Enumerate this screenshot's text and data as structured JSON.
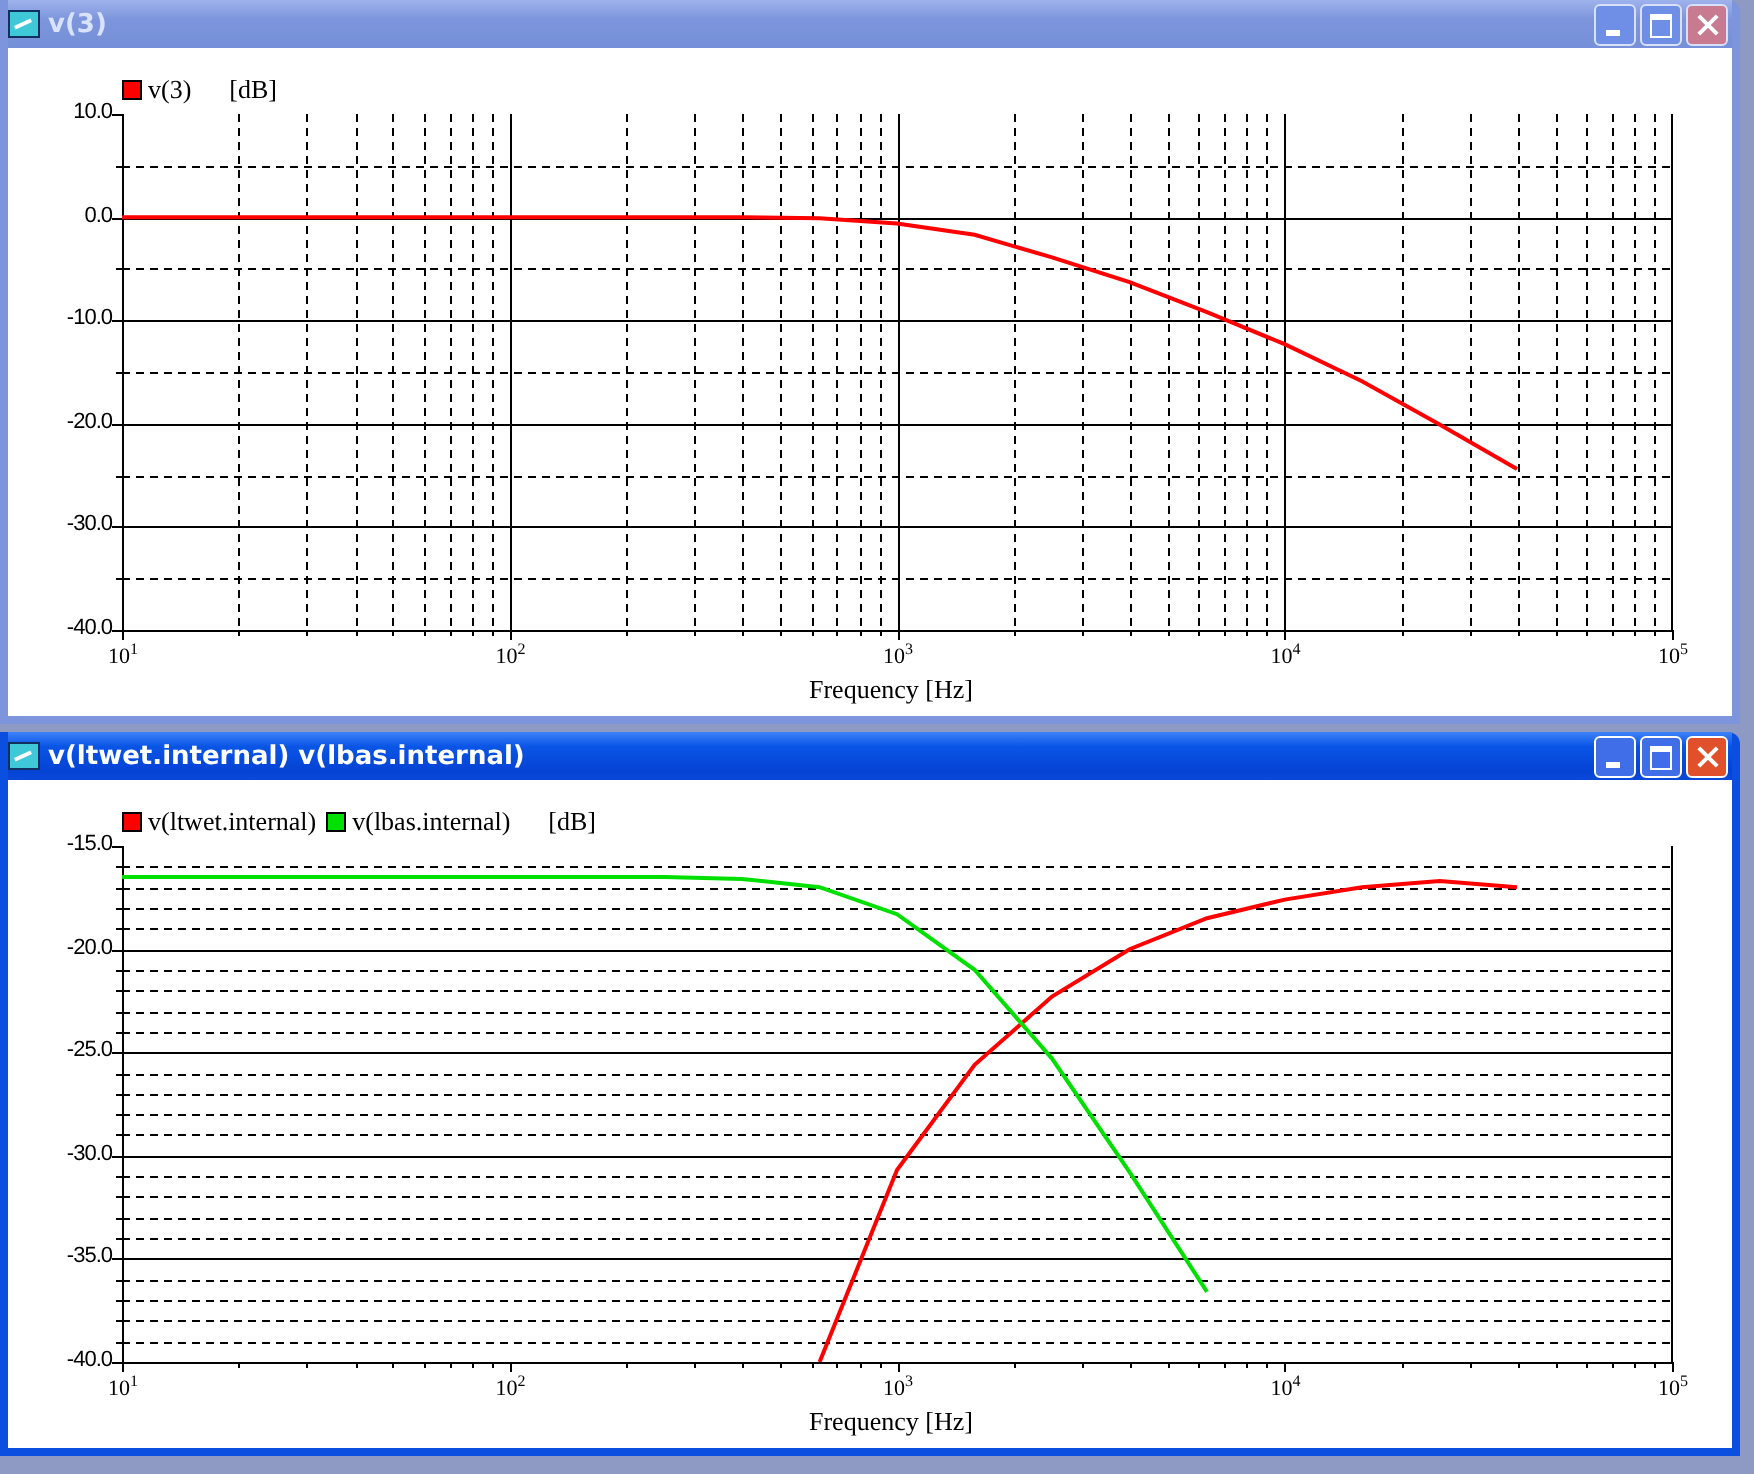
{
  "windows": [
    {
      "title": "v(3)",
      "active": false,
      "chart_data": {
        "type": "line",
        "grid": "both",
        "legend": "top-left",
        "xlabel": "Frequency [Hz]",
        "ylabel": "[dB]",
        "categories": [
          "10$^{1}$",
          null,
          null,
          null,
          null,
          "10$^{2}$",
          null,
          null,
          null,
          null,
          "10$^{3}$",
          null,
          null,
          null,
          null,
          "10$^{4}$",
          null,
          null,
          null,
          null,
          "10$^{5}$"
        ],
        "ylim": [
          -40,
          10
        ],
        "yticks": [
          {
            "value": 10,
            "label": "10.0"
          },
          {
            "value": 0,
            "label": "0.0"
          },
          {
            "value": -10,
            "label": "-10.0"
          },
          {
            "value": -20,
            "label": "-20.0"
          },
          {
            "value": -30,
            "label": "-30.0"
          },
          {
            "value": -40,
            "label": "-40.0"
          }
        ],
        "series": [
          {
            "name": "v(3)",
            "color": "#ff0000",
            "values": [
              0,
              0,
              0,
              0,
              0,
              0,
              0,
              0,
              0,
              -0.1,
              -0.6,
              -1.7,
              -3.9,
              -6.3,
              -9.2,
              -12.3,
              -15.9,
              -20.1,
              -24.4,
              null,
              null
            ]
          }
        ]
      }
    },
    {
      "title": "v(ltwet.internal) v(lbas.internal)",
      "active": true,
      "chart_data": {
        "type": "line",
        "grid": "y",
        "legend": "top-left",
        "xlabel": "Frequency [Hz]",
        "ylabel": "[dB]",
        "categories": [
          "10$^{1}$",
          null,
          null,
          null,
          null,
          "10$^{2}$",
          null,
          null,
          null,
          null,
          "10$^{3}$",
          null,
          null,
          null,
          null,
          "10$^{4}$",
          null,
          null,
          null,
          null,
          "10$^{5}$"
        ],
        "ylim": [
          -40,
          -15
        ],
        "yticks": [
          {
            "value": -15,
            "label": "-15.0"
          },
          {
            "value": -20,
            "label": "-20.0"
          },
          {
            "value": -25,
            "label": "-25.0"
          },
          {
            "value": -30,
            "label": "-30.0"
          },
          {
            "value": -35,
            "label": "-35.0"
          },
          {
            "value": -40,
            "label": "-40.0"
          }
        ],
        "series": [
          {
            "name": "v(ltwet.internal)",
            "color": "#ff0000",
            "values": [
              null,
              null,
              null,
              null,
              null,
              null,
              null,
              null,
              null,
              -40,
              -30.7,
              -25.6,
              -22.3,
              -20.0,
              -18.5,
              -17.6,
              -17.0,
              -16.7,
              -17.0,
              null,
              null
            ]
          },
          {
            "name": "v(lbas.internal)",
            "color": "#00e000",
            "values": [
              -16.5,
              -16.5,
              -16.5,
              -16.5,
              -16.5,
              -16.5,
              -16.5,
              -16.5,
              -16.6,
              -17.0,
              -18.3,
              -21.0,
              -25.3,
              -30.8,
              -36.6,
              null,
              null,
              null,
              null,
              null,
              null
            ]
          }
        ]
      }
    }
  ]
}
